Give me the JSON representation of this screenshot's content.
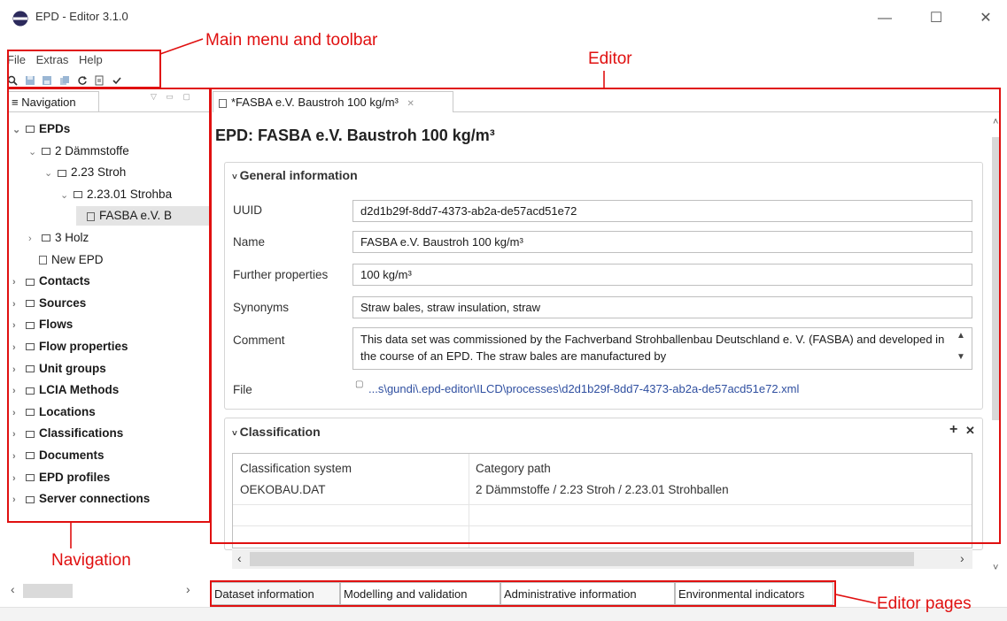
{
  "window": {
    "title": "EPD - Editor 3.1.0",
    "minimize": "—",
    "maximize": "☐",
    "close": "✕"
  },
  "menu": {
    "items": [
      "File",
      "Extras",
      "Help"
    ]
  },
  "toolbar": {
    "icons": [
      "search-icon",
      "save-icon",
      "save-as-icon",
      "copy-icon",
      "refresh-icon",
      "export-icon",
      "validate-icon"
    ]
  },
  "navigation": {
    "tab_label": "Navigation",
    "tree": [
      {
        "label": "EPDs",
        "bold": true,
        "expanded": true,
        "level": 0,
        "kind": "folder"
      },
      {
        "label": "2 Dämmstoffe",
        "bold": false,
        "expanded": true,
        "level": 1,
        "kind": "folder"
      },
      {
        "label": "2.23 Stroh",
        "bold": false,
        "expanded": true,
        "level": 2,
        "kind": "folder"
      },
      {
        "label": "2.23.01 Strohba",
        "bold": false,
        "expanded": true,
        "level": 3,
        "kind": "folder"
      },
      {
        "label": "FASBA e.V. B",
        "bold": false,
        "expanded": false,
        "level": 4,
        "kind": "doc",
        "selected": true
      },
      {
        "label": "3 Holz",
        "bold": false,
        "expanded": false,
        "level": 1,
        "kind": "folder"
      },
      {
        "label": "New EPD",
        "bold": false,
        "expanded": false,
        "level": 1,
        "kind": "doc"
      },
      {
        "label": "Contacts",
        "bold": true,
        "level": 0,
        "kind": "folder"
      },
      {
        "label": "Sources",
        "bold": true,
        "level": 0,
        "kind": "folder"
      },
      {
        "label": "Flows",
        "bold": true,
        "level": 0,
        "kind": "folder"
      },
      {
        "label": "Flow properties",
        "bold": true,
        "level": 0,
        "kind": "folder"
      },
      {
        "label": "Unit groups",
        "bold": true,
        "level": 0,
        "kind": "folder"
      },
      {
        "label": "LCIA Methods",
        "bold": true,
        "level": 0,
        "kind": "folder"
      },
      {
        "label": "Locations",
        "bold": true,
        "level": 0,
        "kind": "folder"
      },
      {
        "label": "Classifications",
        "bold": true,
        "level": 0,
        "kind": "folder"
      },
      {
        "label": "Documents",
        "bold": true,
        "level": 0,
        "kind": "folder"
      },
      {
        "label": "EPD profiles",
        "bold": true,
        "level": 0,
        "kind": "folder"
      },
      {
        "label": "Server connections",
        "bold": true,
        "level": 0,
        "kind": "folder"
      }
    ]
  },
  "editor": {
    "tab_label": "*FASBA e.V. Baustroh 100 kg/m³",
    "heading": "EPD: FASBA e.V. Baustroh 100 kg/m³",
    "general": {
      "title": "General information",
      "uuid_label": "UUID",
      "uuid": "d2d1b29f-8dd7-4373-ab2a-de57acd51e72",
      "name_label": "Name",
      "name": "FASBA e.V. Baustroh 100 kg/m³",
      "further_label": "Further properties",
      "further": "100 kg/m³",
      "synonyms_label": "Synonyms",
      "synonyms": "Straw bales, straw insulation, straw",
      "comment_label": "Comment",
      "comment": "This data set was commissioned by the Fachverband Strohballenbau Deutschland e. V. (FASBA) and developed in the course of an EPD. The straw bales are manufactured by",
      "file_label": "File",
      "file": "...s\\gundi\\.epd-editor\\ILCD\\processes\\d2d1b29f-8dd7-4373-ab2a-de57acd51e72.xml"
    },
    "classification": {
      "title": "Classification",
      "add": "+",
      "remove": "✕",
      "col_system": "Classification system",
      "col_path": "Category path",
      "row_system": "OEKOBAU.DAT",
      "row_path": "2 Dämmstoffe / 2.23 Stroh / 2.23.01 Strohballen"
    },
    "pages": [
      "Dataset information",
      "Modelling and validation",
      "Administrative information",
      "Environmental indicators"
    ]
  },
  "annotations": {
    "menu": "Main menu and toolbar",
    "editor": "Editor",
    "navigation": "Navigation",
    "pages": "Editor pages"
  }
}
